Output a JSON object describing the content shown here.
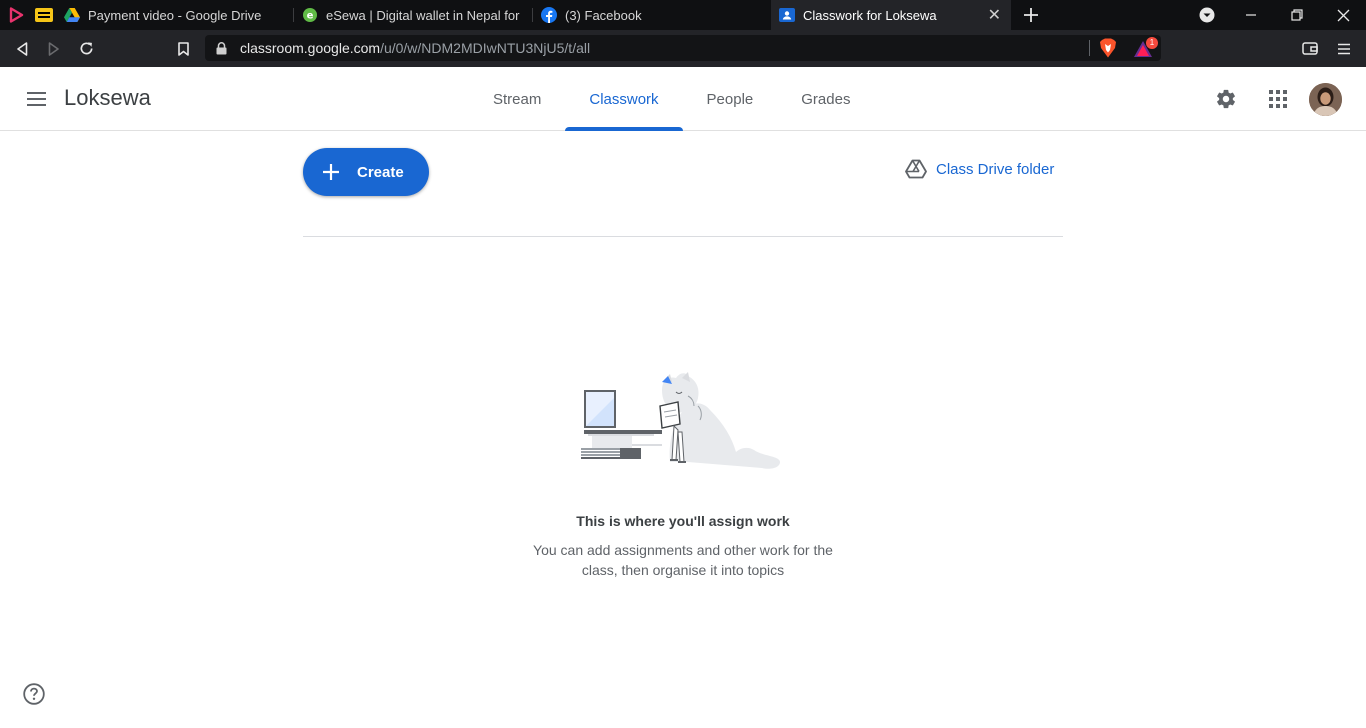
{
  "browser": {
    "tabs": [
      {
        "title": "Payment video - Google Drive",
        "favicon": "google-drive-icon"
      },
      {
        "title": "eSewa | Digital wallet in Nepal for Onli",
        "favicon": "esewa-icon"
      },
      {
        "title": "(3) Facebook",
        "favicon": "facebook-icon"
      },
      {
        "title": "Classwork for Loksewa",
        "favicon": "google-classroom-icon",
        "active": true
      }
    ],
    "url_host": "classroom.google.com",
    "url_path": "/u/0/w/NDM2MDIwNTU3NjU5/t/all",
    "brave_badge_count": "1"
  },
  "header": {
    "class_name": "Loksewa",
    "tabs": [
      {
        "label": "Stream"
      },
      {
        "label": "Classwork",
        "active": true
      },
      {
        "label": "People"
      },
      {
        "label": "Grades"
      }
    ]
  },
  "main": {
    "create_label": "Create",
    "drive_folder_label": "Class Drive folder",
    "empty_title": "This is where you'll assign work",
    "empty_body_line1": "You can add assignments and other work for the",
    "empty_body_line2": "class, then organise it into topics"
  },
  "colors": {
    "accent": "#1967d2",
    "tab_bar": "#0f1012",
    "toolbar": "#232428"
  }
}
